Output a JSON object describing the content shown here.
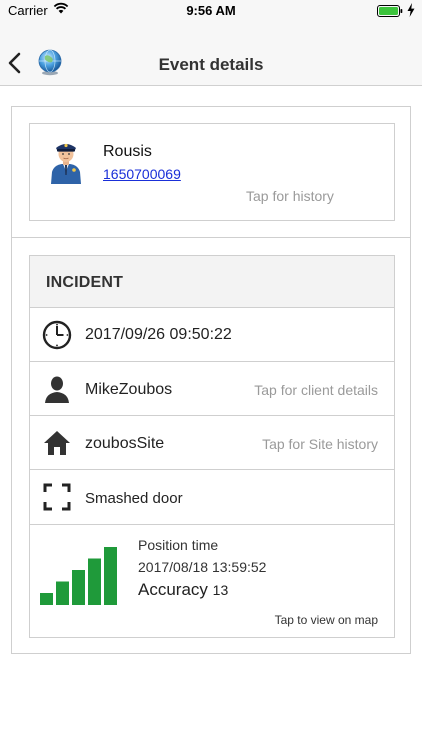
{
  "status_bar": {
    "carrier": "Carrier",
    "time": "9:56 AM"
  },
  "nav": {
    "title": "Event details",
    "back_icon": "chevron-left-icon",
    "logo_icon": "globe-icon"
  },
  "person": {
    "name": "Rousis",
    "phone": "1650700069",
    "history_hint": "Tap for history"
  },
  "incident": {
    "header": "INCIDENT",
    "datetime": "2017/09/26 09:50:22",
    "client": "MikeZoubos",
    "client_hint": "Tap for client details",
    "site": "zoubosSite",
    "site_hint": "Tap for Site history",
    "description": "Smashed door",
    "position_time_label": "Position time",
    "position_time": "2017/08/18 13:59:52",
    "accuracy_label": "Accuracy",
    "accuracy_value": "13",
    "map_hint": "Tap to view on map",
    "signal_level": 5,
    "signal_max": 5
  },
  "colors": {
    "accent_link": "#1a2fd8",
    "signal_green": "#1f9a3a",
    "battery_green": "#3cc43c"
  }
}
